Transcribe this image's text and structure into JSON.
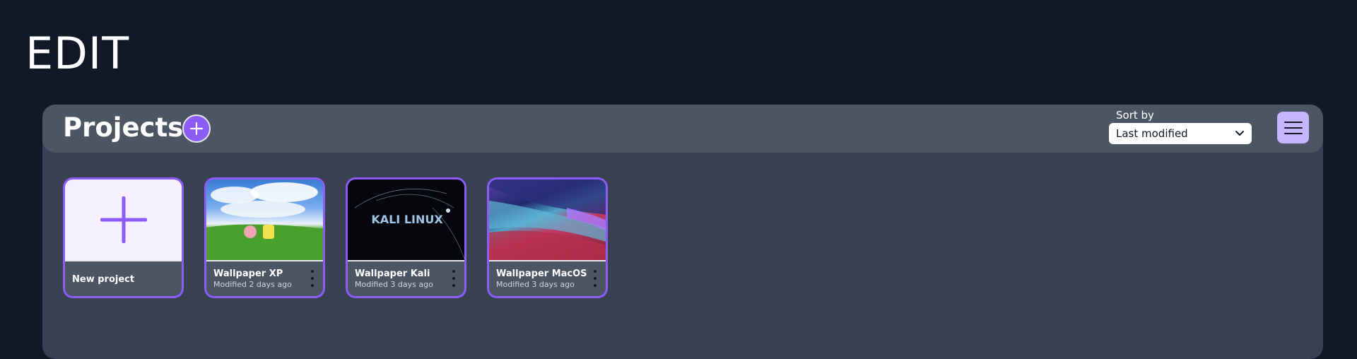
{
  "app": {
    "title": "EDIT"
  },
  "projects": {
    "title": "Projects",
    "sort": {
      "label": "Sort by",
      "selected": "Last modified"
    },
    "cards": [
      {
        "name": "New project",
        "date": "",
        "thumbnail": "plus-icon"
      },
      {
        "name": "Wallpaper XP",
        "date": "Modified 2 days ago",
        "thumbnail": "wallpaper-xp"
      },
      {
        "name": "Wallpaper Kali",
        "date": "Modified 3 days ago",
        "thumbnail": "wallpaper-kali",
        "thumb_text": "KALI LINUX"
      },
      {
        "name": "Wallpaper MacOS",
        "date": "Modified 3 days ago",
        "thumbnail": "wallpaper-macos"
      }
    ]
  },
  "colors": {
    "background": "#111827",
    "panel": "#374151",
    "panel_header": "#4b5563",
    "accent": "#8b5cf6",
    "menu_button": "#c4b5fd"
  }
}
